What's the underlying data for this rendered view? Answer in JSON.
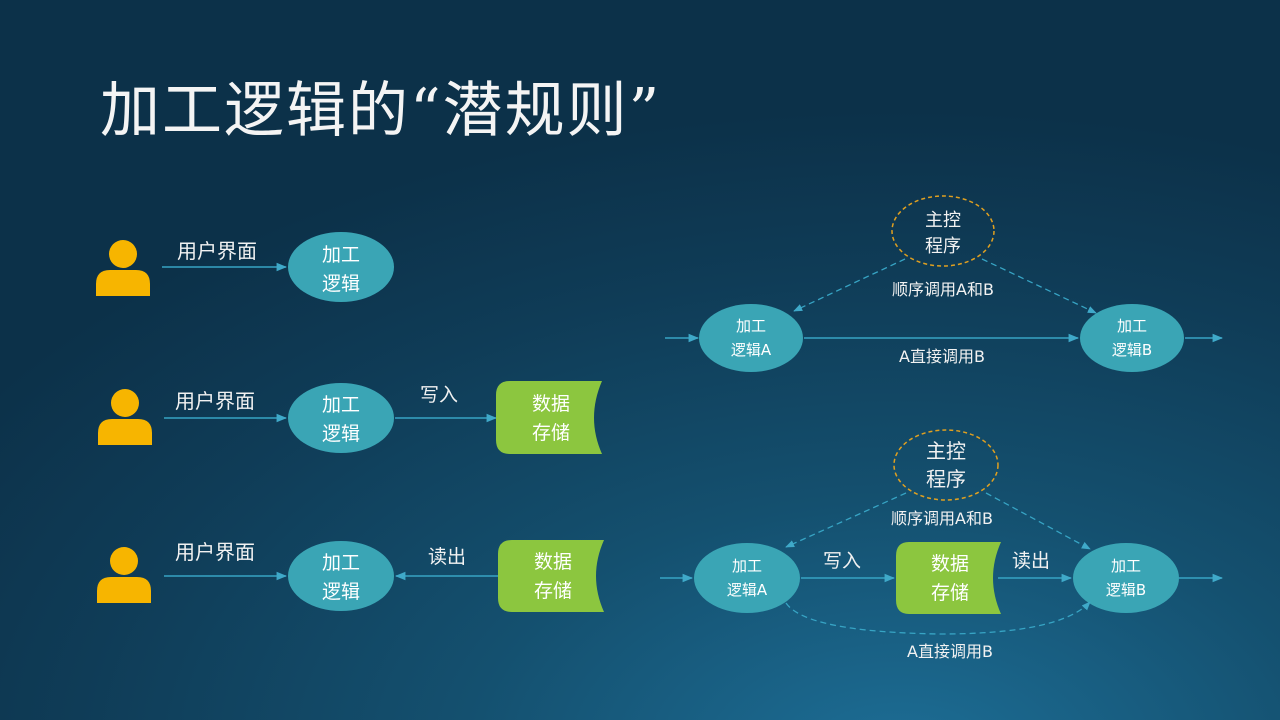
{
  "title": "加工逻辑的“潜规则”",
  "labels": {
    "user_interface": "用户界面",
    "logic_line1": "加工",
    "logic_line2": "逻辑",
    "write": "写入",
    "read": "读出",
    "storage_line1": "数据",
    "storage_line2": "存储",
    "master_line1": "主控",
    "master_line2": "程序",
    "logic_a_line2": "逻辑A",
    "logic_b_line2": "逻辑B",
    "sequential_call": "顺序调用A和B",
    "direct_call": "A直接调用B"
  },
  "colors": {
    "node_fill": "#3aa5b5",
    "storage_fill": "#8cc63f",
    "user_icon": "#f7b500",
    "master_border": "#e0a020",
    "line": "#37a4c4"
  }
}
